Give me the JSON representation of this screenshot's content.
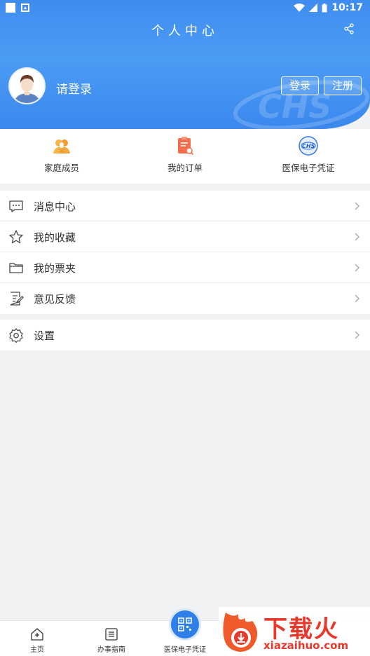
{
  "status_bar": {
    "time": "10:17"
  },
  "header": {
    "title": "个人中心",
    "login_prompt": "请登录",
    "login_button": "登录",
    "register_button": "注册",
    "watermark_text": "CHS"
  },
  "shortcuts": [
    {
      "label": "家庭成员",
      "icon": "family-icon"
    },
    {
      "label": "我的订单",
      "icon": "order-icon"
    },
    {
      "label": "医保电子凭证",
      "icon": "chs-certificate-icon"
    }
  ],
  "menu": [
    {
      "label": "消息中心",
      "icon": "message-icon"
    },
    {
      "label": "我的收藏",
      "icon": "star-icon"
    },
    {
      "label": "我的票夹",
      "icon": "folder-icon"
    },
    {
      "label": "意见反馈",
      "icon": "feedback-icon"
    }
  ],
  "settings": {
    "label": "设置",
    "icon": "gear-icon"
  },
  "bottom_nav": [
    {
      "label": "主页",
      "icon": "home-icon"
    },
    {
      "label": "办事指南",
      "icon": "guide-icon"
    },
    {
      "label": "医保电子凭证",
      "icon": "qr-code-icon"
    }
  ],
  "watermark": {
    "title": "下载火",
    "subtitle": "xiazaihuo.com"
  },
  "colors": {
    "header_blue": "#3f8cef",
    "accent": "#2f7fe8",
    "watermark_red": "#e8382c"
  }
}
